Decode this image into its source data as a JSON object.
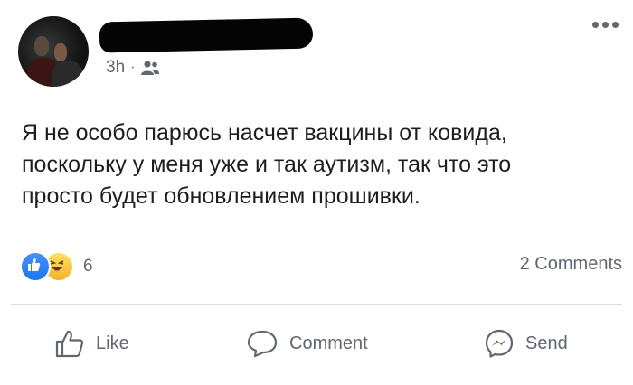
{
  "post": {
    "timestamp": "3h",
    "separator": "·",
    "audience_icon": "friends-icon",
    "text": "Я не особо парюсь насчет вакцины от ковида,\nпоскольку у меня уже и так аутизм, так что это\nпросто будет обновлением прошивки.",
    "reactions": {
      "icons": [
        "like-reaction-icon",
        "haha-reaction-icon"
      ],
      "count": "6"
    },
    "comments_count": "2 Comments"
  },
  "actions": {
    "like_label": "Like",
    "comment_label": "Comment",
    "send_label": "Send"
  },
  "colors": {
    "text": "#1c1e21",
    "secondary_text": "#606770",
    "like_blue": "#1877f2",
    "haha_yellow": "#f7b125",
    "divider": "#dadde1"
  }
}
